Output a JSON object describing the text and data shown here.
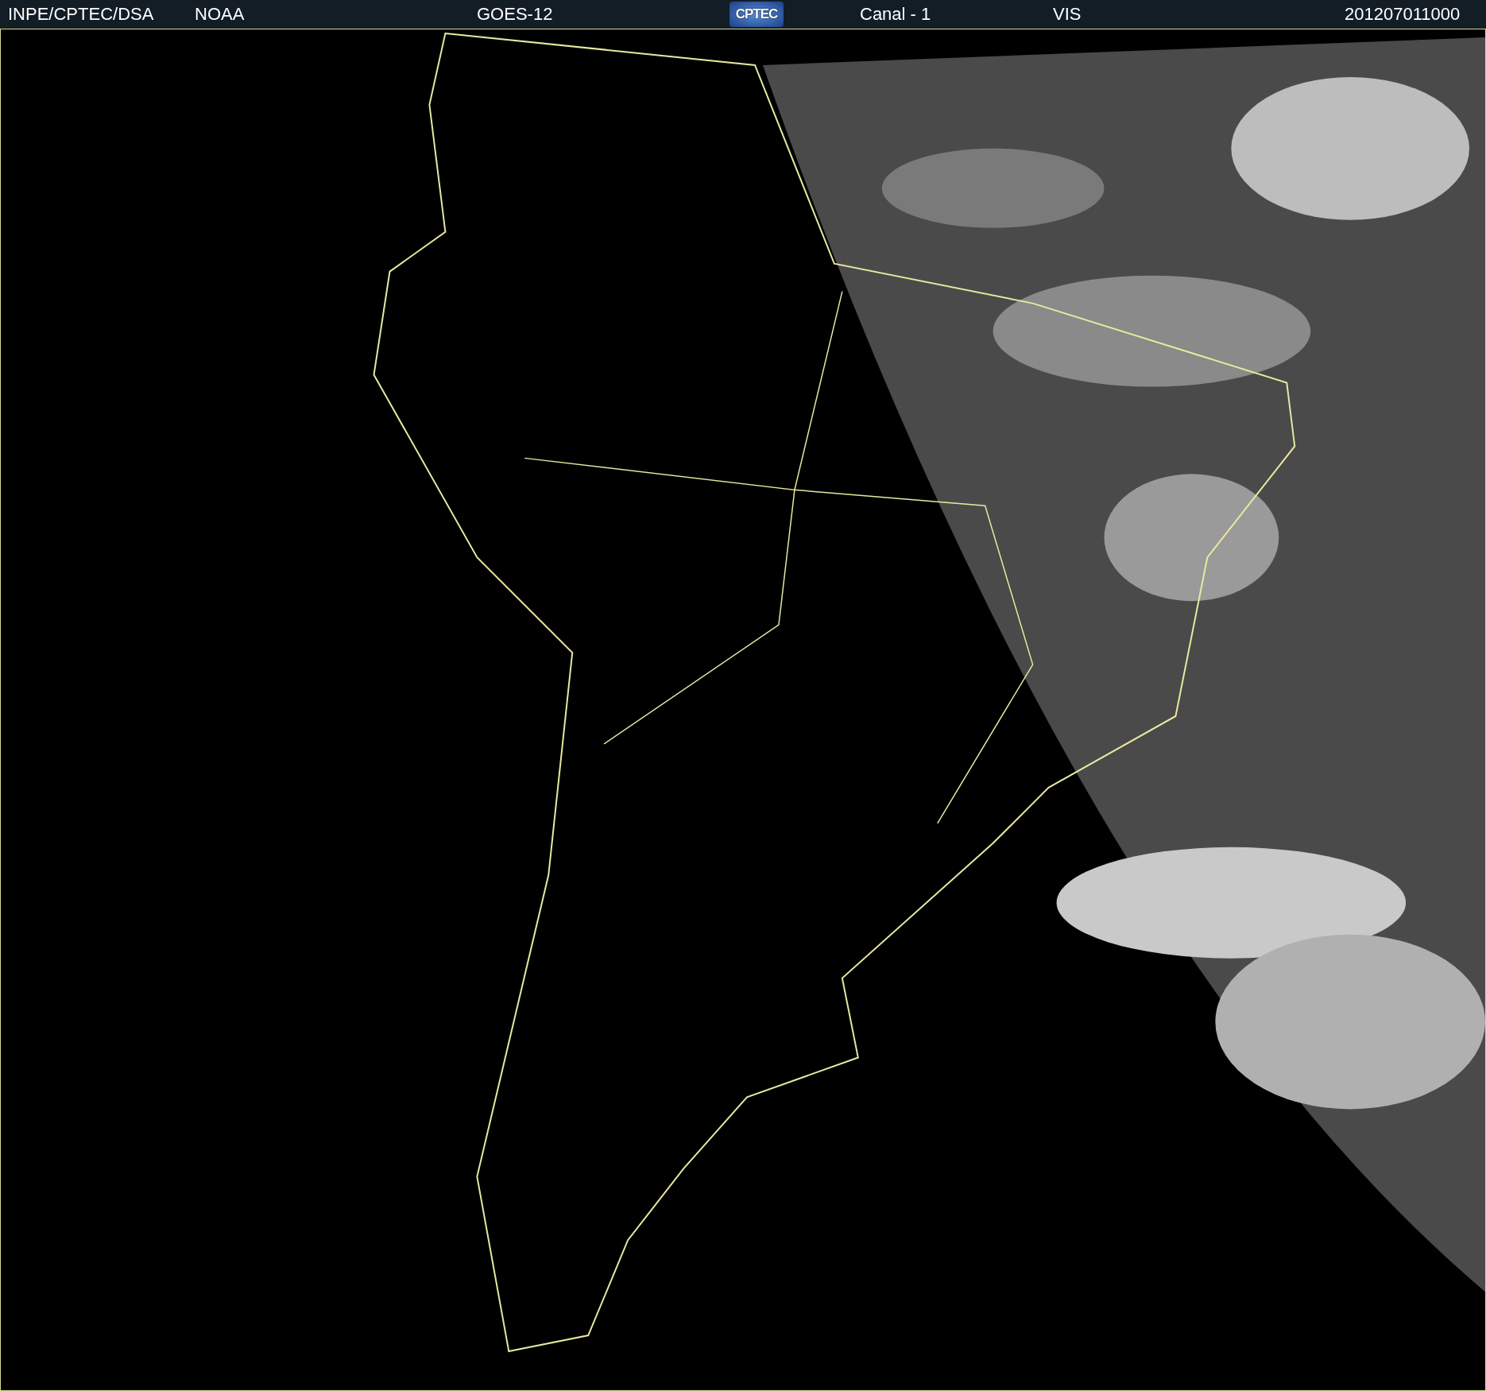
{
  "header": {
    "items": [
      {
        "kind": "text",
        "text": "INPE/CPTEC/DSA"
      },
      {
        "kind": "text",
        "text": "NOAA"
      },
      {
        "kind": "text",
        "text": "GOES-12"
      },
      {
        "kind": "logo",
        "text": "CPTEC"
      },
      {
        "kind": "text",
        "text": "Canal - 1"
      },
      {
        "kind": "text",
        "text": "VIS"
      },
      {
        "kind": "text",
        "text": "201207011000"
      }
    ]
  }
}
